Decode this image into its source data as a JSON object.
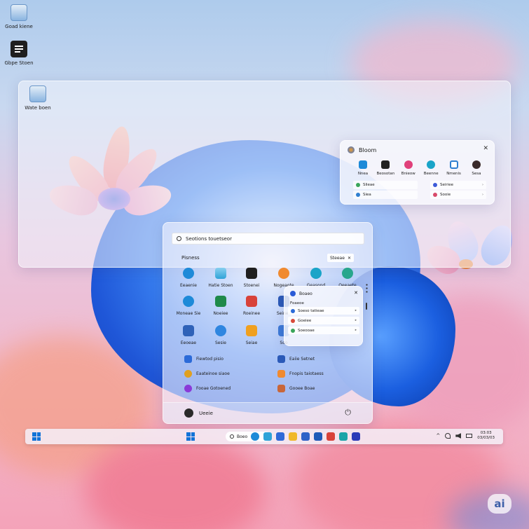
{
  "desktop": {
    "icons": [
      {
        "label": "Goad kiene",
        "icon": "recycle-bin-icon",
        "color": "#7aa8d8"
      },
      {
        "label": "Gbpe Stoen",
        "icon": "document-app-icon",
        "color": "#1f1f1f"
      },
      {
        "label": "Wate boen",
        "icon": "recycle-bin-icon",
        "color": "#7aa8d8"
      }
    ]
  },
  "bloom_window": {
    "title": "Bloom",
    "close": "✕",
    "apps": [
      {
        "label": "Nnea",
        "icon": "edge-icon",
        "color": "#1e8ad8"
      },
      {
        "label": "Beosotan",
        "icon": "terminal-icon",
        "color": "#222222"
      },
      {
        "label": "Bnieow",
        "icon": "flower-icon",
        "color": "#e0407a"
      },
      {
        "label": "Beenne",
        "icon": "maps-icon",
        "color": "#1aa4c8"
      },
      {
        "label": "Nmenis",
        "icon": "camera-icon",
        "color": "#2f7fd0"
      },
      {
        "label": "Sesa",
        "icon": "avatar-icon",
        "color": "#3a2a2a"
      }
    ],
    "rows_left": [
      {
        "label": "Slieae",
        "color": "#3aa55a"
      },
      {
        "label": "Siea",
        "color": "#2f7fd0"
      }
    ],
    "rows_right": [
      {
        "label": "Seiriee",
        "color": "#3c5ad8"
      },
      {
        "label": "Sooie",
        "color": "#d84a6a"
      }
    ],
    "chevron": "›"
  },
  "start_menu": {
    "search_placeholder": "Seotions touetseor",
    "pinned_label": "Pisness",
    "pinned_chip": "Steeae",
    "pinned_chip_x": "✕",
    "apps": [
      {
        "label": "Eeaenie",
        "icon": "edge-icon",
        "color": "#1e8ad8"
      },
      {
        "label": "Hatie Stoen",
        "icon": "photos-icon",
        "color": "#2fa3d8"
      },
      {
        "label": "Stoenei",
        "icon": "terminal-icon",
        "color": "#1f1f1f"
      },
      {
        "label": "Nogeaote",
        "icon": "flower-icon",
        "color": "#f08a30"
      },
      {
        "label": "Geasond",
        "icon": "maps-icon",
        "color": "#1aa4c8"
      },
      {
        "label": "Oeeaete",
        "icon": "edge-icon",
        "color": "#28a68c"
      },
      {
        "label": "Moneae Sie",
        "icon": "edge-icon",
        "color": "#1e8ad8"
      },
      {
        "label": "Noeiee",
        "icon": "excel-icon",
        "color": "#1f8a4a"
      },
      {
        "label": "Roeinee",
        "icon": "powerpoint-icon",
        "color": "#d8423a"
      },
      {
        "label": "Seinee",
        "icon": "word-icon",
        "color": "#2b5ab8"
      },
      {
        "label": "Eeoeae",
        "icon": "photos-icon",
        "color": "#2f62b8"
      },
      {
        "label": "Sesie",
        "icon": "messenger-icon",
        "color": "#2f86e0"
      },
      {
        "label": "Seiae",
        "icon": "calculator-icon",
        "color": "#f0a020"
      },
      {
        "label": "Soo",
        "icon": "settings-icon",
        "color": "#3c7ad8"
      }
    ],
    "recent": [
      {
        "label": "Fiewtod pisio",
        "icon": "file-icon",
        "color": "#2b6ad8"
      },
      {
        "label": "Eaiie Setnet",
        "icon": "file-icon",
        "color": "#2b5ab8"
      },
      {
        "label": "Eaateinoe siaoe",
        "icon": "chrome-icon",
        "color": "#e0a020"
      },
      {
        "label": "Fnopis taiotaess",
        "icon": "file-icon",
        "color": "#f08a30"
      },
      {
        "label": "Fooae Gotoened",
        "icon": "circle-app-icon",
        "color": "#8a3ad8"
      },
      {
        "label": "Gooee Boae",
        "icon": "folder-icon",
        "color": "#c8663a"
      }
    ],
    "user_name": "Ueeie",
    "power_icon": "⏻"
  },
  "flyout": {
    "title": "Boaeo",
    "close": "✕",
    "label": "Foaeoe",
    "rows": [
      {
        "label": "Soeso tatieae",
        "color": "#2b6ad8"
      },
      {
        "label": "Goeiee",
        "color": "#d84a3a"
      },
      {
        "label": "Soeooae",
        "color": "#3aa55a"
      }
    ],
    "chevron": "▸"
  },
  "taskbar": {
    "search_label": "Boeo",
    "apps": [
      {
        "icon": "edge-icon",
        "color": "#1e8ad8"
      },
      {
        "icon": "photos-icon",
        "color": "#2fa3d8"
      },
      {
        "icon": "file-explorer-icon",
        "color": "#2f6ad8"
      },
      {
        "icon": "folder-icon",
        "color": "#f0b82a"
      },
      {
        "icon": "store-icon",
        "color": "#2f62c8"
      },
      {
        "icon": "mail-icon",
        "color": "#1f5ab8"
      },
      {
        "icon": "calendar-icon",
        "color": "#d8423a"
      },
      {
        "icon": "teams-icon",
        "color": "#1aa4a8"
      },
      {
        "icon": "settings-icon",
        "color": "#2b3ab8"
      }
    ],
    "tray_chevron": "^",
    "clock_time": "03:03",
    "clock_date": "03/03/03"
  },
  "badge": "ai"
}
